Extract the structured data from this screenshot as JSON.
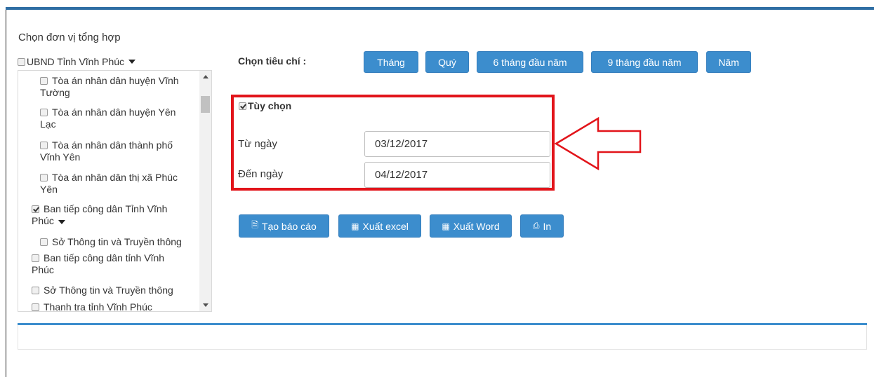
{
  "section_title": "Chọn đơn vị tổng hợp",
  "tree": {
    "root_label": "UBND Tỉnh Vĩnh Phúc",
    "items": [
      {
        "lines": [
          "Tòa án nhân dân huyện Vĩnh",
          "Tường"
        ],
        "checked": false
      },
      {
        "lines": [
          "Tòa án nhân dân huyện Yên",
          "Lạc"
        ],
        "checked": false
      },
      {
        "lines": [
          "Tòa án nhân dân thành phố",
          "Vĩnh Yên"
        ],
        "checked": false
      },
      {
        "lines": [
          "Tòa án nhân dân thị xã Phúc",
          "Yên"
        ],
        "checked": false
      },
      {
        "lines": [
          "Ban tiếp công dân Tỉnh Vĩnh",
          "Phúc"
        ],
        "checked": true
      },
      {
        "lines": [
          "Sở Thông tin và Truyền thông"
        ],
        "checked": false
      },
      {
        "lines": [
          "Ban tiếp công dân tỉnh Vĩnh",
          "Phúc"
        ],
        "checked": false
      },
      {
        "lines": [
          "Sở Thông tin và Truyền thông"
        ],
        "checked": false
      },
      {
        "lines": [
          "Thanh tra tỉnh Vĩnh Phúc"
        ],
        "checked": false
      }
    ]
  },
  "criteria": {
    "label": "Chọn tiêu chí :",
    "buttons": [
      "Tháng",
      "Quý",
      "6 tháng đầu năm",
      "9 tháng đầu năm",
      "Năm"
    ]
  },
  "custom": {
    "option_label": "Tùy chọn",
    "option_checked": true,
    "from_label": "Từ ngày",
    "from_value": "03/12/2017",
    "to_label": "Đến ngày",
    "to_value": "04/12/2017"
  },
  "actions": {
    "create_report": "Tạo báo cáo",
    "export_excel": "Xuất excel",
    "export_word": "Xuất Word",
    "print": "In"
  },
  "colors": {
    "accent": "#3c8dcd",
    "highlight_border": "#e2141a"
  }
}
